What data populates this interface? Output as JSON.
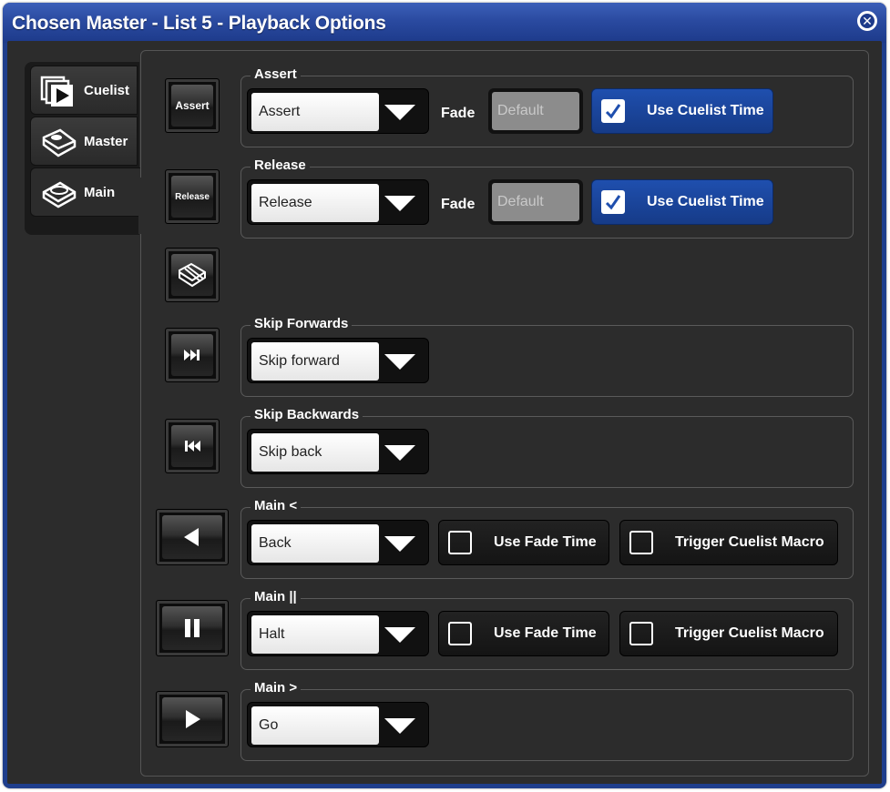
{
  "window": {
    "title": "Chosen Master - List 5 - Playback Options"
  },
  "tabs": [
    {
      "label": "Cuelist",
      "icon": "cuelist-icon"
    },
    {
      "label": "Master",
      "icon": "master-fader-icon"
    },
    {
      "label": "Main",
      "icon": "main-playback-icon",
      "active": true
    }
  ],
  "buttons": {
    "assert": "Assert",
    "release": "Release"
  },
  "groups": {
    "assert": {
      "title": "Assert",
      "option": "Assert",
      "fade_label": "Fade",
      "fade_placeholder": "Default",
      "use_cuelist_time": "Use Cuelist Time",
      "use_cuelist_time_checked": true
    },
    "release": {
      "title": "Release",
      "option": "Release",
      "fade_label": "Fade",
      "fade_placeholder": "Default",
      "use_cuelist_time": "Use Cuelist Time",
      "use_cuelist_time_checked": true
    },
    "skip_forwards": {
      "title": "Skip Forwards",
      "option": "Skip forward"
    },
    "skip_backwards": {
      "title": "Skip Backwards",
      "option": "Skip back"
    },
    "main_back": {
      "title": "Main <",
      "option": "Back",
      "use_fade_time": "Use Fade Time",
      "trigger_macro": "Trigger Cuelist Macro"
    },
    "main_halt": {
      "title": "Main ||",
      "option": "Halt",
      "use_fade_time": "Use Fade Time",
      "trigger_macro": "Trigger Cuelist Macro"
    },
    "main_go": {
      "title": "Main >",
      "option": "Go"
    }
  },
  "colors": {
    "title_bar": "#2a4aa0",
    "panel_bg": "#2c2c2c",
    "checked_button": "#1f4fae"
  }
}
